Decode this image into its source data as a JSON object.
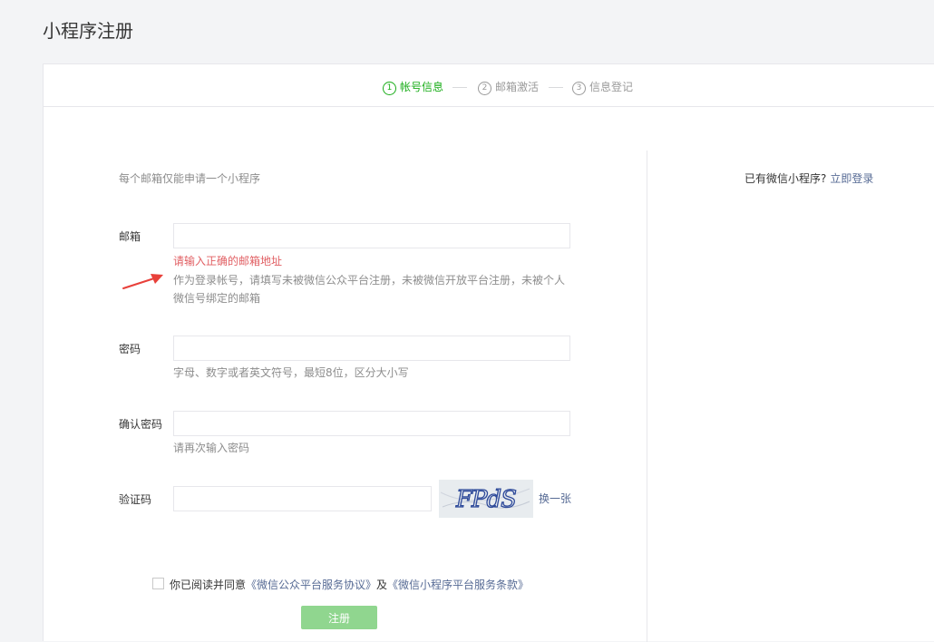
{
  "page_title": "小程序注册",
  "steps": [
    {
      "num": "1",
      "label": "帐号信息",
      "active": true
    },
    {
      "num": "2",
      "label": "邮箱激活",
      "active": false
    },
    {
      "num": "3",
      "label": "信息登记",
      "active": false
    }
  ],
  "intro": "每个邮箱仅能申请一个小程序",
  "login": {
    "prompt": "已有微信小程序?",
    "link": "立即登录"
  },
  "form": {
    "email": {
      "label": "邮箱",
      "value": "",
      "error": "请输入正确的邮箱地址",
      "hint": "作为登录帐号，请填写未被微信公众平台注册，未被微信开放平台注册，未被个人微信号绑定的邮箱"
    },
    "password": {
      "label": "密码",
      "value": "",
      "hint": "字母、数字或者英文符号，最短8位，区分大小写"
    },
    "confirm_password": {
      "label": "确认密码",
      "value": "",
      "hint": "请再次输入密码"
    },
    "captcha": {
      "label": "验证码",
      "value": "",
      "image_text": "FPdS",
      "refresh": "换一张"
    }
  },
  "agreement": {
    "prefix": "你已阅读并同意",
    "link1": "《微信公众平台服务协议》",
    "and": "及",
    "link2": "《微信小程序平台服务条款》",
    "checked": false
  },
  "submit_label": "注册",
  "colors": {
    "accent": "#1aad19",
    "link": "#576b95",
    "error": "#e15f63",
    "submit_disabled": "#90d68f"
  }
}
